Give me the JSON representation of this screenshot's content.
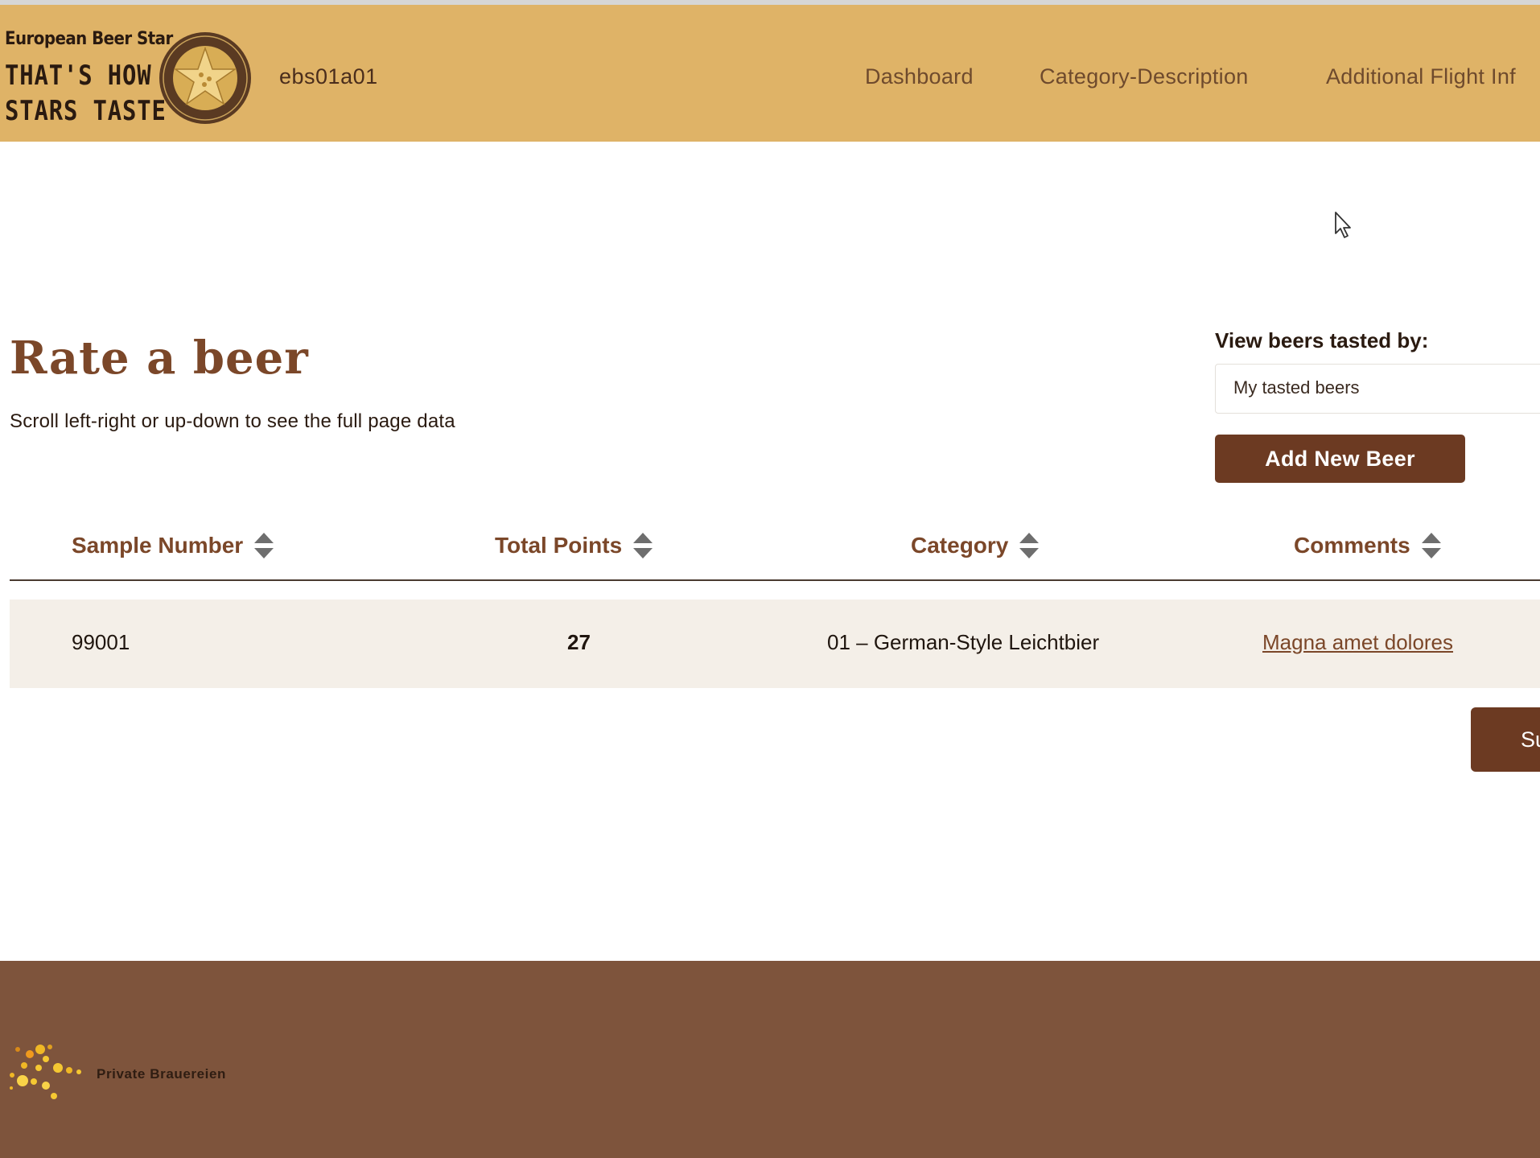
{
  "header": {
    "brand_small": "European Beer Star",
    "slogan_line1": "THAT'S HOW",
    "slogan_line2": "STARS TASTE",
    "username": "ebs01a01",
    "nav": [
      {
        "label": "Dashboard"
      },
      {
        "label": "Category-Description"
      },
      {
        "label": "Additional Flight Inf"
      }
    ]
  },
  "main": {
    "title": "Rate a beer",
    "subtitle": "Scroll left-right or up-down to see the full page data",
    "view_label": "View beers tasted by:",
    "view_selected": "My tasted beers",
    "add_button": "Add New Beer",
    "submit_button": "Su"
  },
  "table": {
    "columns": [
      "Sample Number",
      "Total Points",
      "Category",
      "Comments"
    ],
    "rows": [
      {
        "sample_number": "99001",
        "total_points": "27",
        "category": "01 – German-Style Leichtbier",
        "comments": "Magna amet dolores"
      }
    ]
  },
  "footer": {
    "brand": "Private Brauereien"
  },
  "colors": {
    "header_bg": "#dfb367",
    "accent_brown": "#6c3a22",
    "title_brown": "#7b4729",
    "row_bg": "#f4efe8",
    "footer_bg": "#7e543c"
  },
  "icons": [
    "seal-logo-icon",
    "sort-icon",
    "mouse-cursor-icon",
    "dots-logo-icon"
  ]
}
